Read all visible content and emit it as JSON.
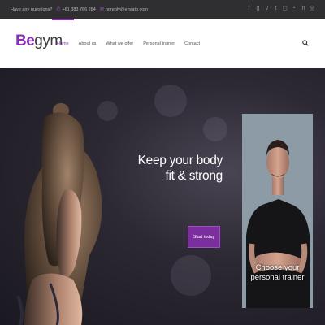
{
  "topbar": {
    "question": "Have any questions?",
    "phone": "+61 383 766 284",
    "email": "noreply@envato.com",
    "social_icons": [
      "facebook-icon",
      "google-plus-icon",
      "vimeo-icon",
      "twitter-icon",
      "instagram-icon",
      "rss-icon",
      "linkedin-icon",
      "dribbble-icon"
    ]
  },
  "header": {
    "logo_be": "Be",
    "logo_gym": "gym",
    "nav": [
      "Home",
      "About us",
      "What we offer",
      "Personal trainer",
      "Contact"
    ],
    "active_nav": "Home"
  },
  "hero": {
    "headline_line1": "Keep your body",
    "headline_line2": "fit & strong",
    "cta_label": "Start today"
  },
  "trainer_card": {
    "caption_line1": "Choose your",
    "caption_line2": "personal trainer"
  },
  "colors": {
    "accent": "#8a2fb8",
    "topbar_bg": "#2f2f31",
    "cta_bg": "#7b2f9e"
  }
}
